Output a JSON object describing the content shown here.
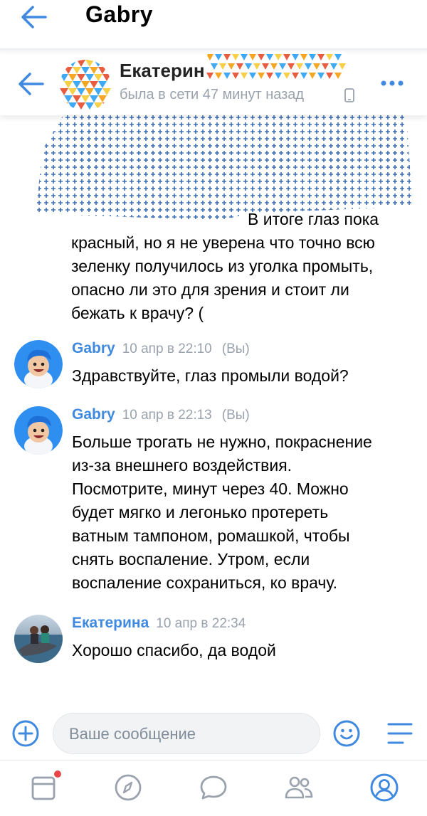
{
  "appbar": {
    "title": "Gabry"
  },
  "chat_header": {
    "name": "Екатерин",
    "status": "была в сети 47 минут назад"
  },
  "messages": {
    "first_partial": {
      "line1": "В итоге глаз пока",
      "line2": "красный, но я не уверена что точно всю",
      "line3": "зеленку получилось из уголка промыть,",
      "line4": "опасно ли это для зрения и стоит ли",
      "line5": "бежать к врачу? ("
    },
    "m1": {
      "author": "Gabry",
      "time": "10 апр в 22:10",
      "you": "(Вы)",
      "text": "Здравствуйте, глаз промыли водой?"
    },
    "m2": {
      "author": "Gabry",
      "time": "10 апр в 22:13",
      "you": "(Вы)",
      "lines": [
        "Больше трогать не нужно, покраснение",
        "из-за внешнего воздействия.",
        "Посмотрите, минут через 40. Можно",
        "будет мягко и легонько протереть",
        "ватным тампоном, ромашкой, чтобы",
        "снять воспаление. Утром, если",
        "воспаление сохраниться, ко врачу."
      ]
    },
    "m3": {
      "author": "Екатерина",
      "time": "10 апр в 22:34",
      "text": "Хорошо спасибо, да водой"
    }
  },
  "composer": {
    "placeholder": "Ваше сообщение"
  },
  "colors": {
    "accent": "#3f8ae0",
    "muted": "#99a2ad",
    "badge": "#e64646"
  },
  "tabs": [
    {
      "icon": "news-icon",
      "badge": true
    },
    {
      "icon": "compass-icon",
      "badge": false
    },
    {
      "icon": "messages-icon",
      "badge": false
    },
    {
      "icon": "friends-icon",
      "badge": false
    },
    {
      "icon": "profile-icon",
      "badge": false,
      "active": true
    }
  ]
}
